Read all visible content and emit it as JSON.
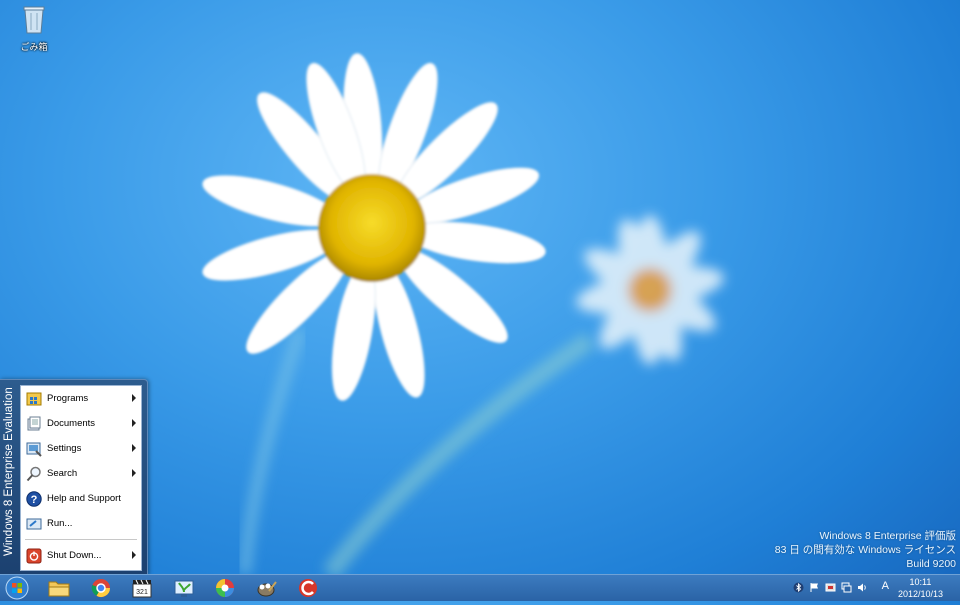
{
  "desktop": {
    "icons": [
      {
        "label": "ごみ箱",
        "icon": "recycle-bin-icon"
      }
    ]
  },
  "watermark": {
    "line1": "Windows 8 Enterprise 評価版",
    "line2": "83 日 の間有効な Windows ライセンス",
    "line3": "Build 9200"
  },
  "start_menu": {
    "banner": "Windows 8 Enterprise Evaluation",
    "items": [
      {
        "label": "Programs",
        "icon": "programs-icon",
        "submenu": true
      },
      {
        "label": "Documents",
        "icon": "documents-icon",
        "submenu": true
      },
      {
        "label": "Settings",
        "icon": "settings-icon",
        "submenu": true
      },
      {
        "label": "Search",
        "icon": "search-icon",
        "submenu": true
      },
      {
        "label": "Help and Support",
        "icon": "help-icon",
        "submenu": false
      },
      {
        "label": "Run...",
        "icon": "run-icon",
        "submenu": false
      },
      {
        "label": "Shut Down...",
        "icon": "shutdown-icon",
        "submenu": true
      }
    ]
  },
  "taskbar": {
    "apps": [
      "file-explorer-icon",
      "chrome-icon",
      "media-clapper-icon",
      "network-plant-icon",
      "color-wheel-icon",
      "gimp-icon",
      "ccleaner-icon"
    ],
    "tray": {
      "ime": "A",
      "time": "10:11",
      "date": "2012/10/13"
    }
  },
  "colors": {
    "taskbar": "#2f6bb0",
    "accent": "#3a9be8"
  }
}
